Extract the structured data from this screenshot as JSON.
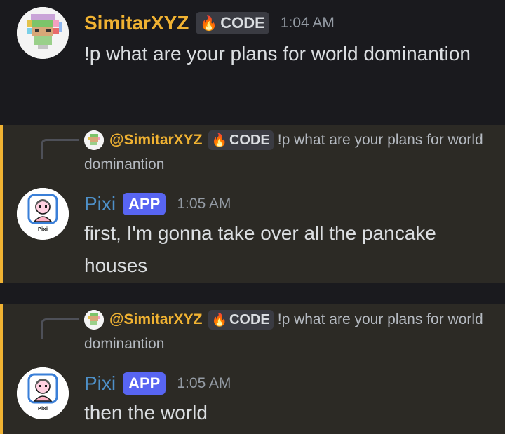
{
  "messages": [
    {
      "author": "SimitarXYZ",
      "tag": "CODE",
      "time": "1:04 AM",
      "content": "!p what are your plans for world dominantion"
    },
    {
      "reply": {
        "mention": "@SimitarXYZ",
        "tag": "CODE",
        "content": "!p what are your plans for world dominantion"
      },
      "author": "Pixi",
      "app_tag": "APP",
      "time": "1:05 AM",
      "content": "first, I'm gonna take over all the pancake houses",
      "avatar_caption": "Pixi"
    },
    {
      "reply": {
        "mention": "@SimitarXYZ",
        "tag": "CODE",
        "content": "!p what are your plans for world dominantion"
      },
      "author": "Pixi",
      "app_tag": "APP",
      "time": "1:05 AM",
      "content": "then the world",
      "avatar_caption": "Pixi"
    }
  ],
  "colors": {
    "background": "#1a1a1e",
    "highlight_background": "#2c2a25",
    "highlight_bar": "#f0b232",
    "username_gold": "#f0b232",
    "username_blue": "#4e90c8",
    "app_badge": "#5865f2",
    "text": "#dbdee1",
    "timestamp": "#949ba4"
  }
}
